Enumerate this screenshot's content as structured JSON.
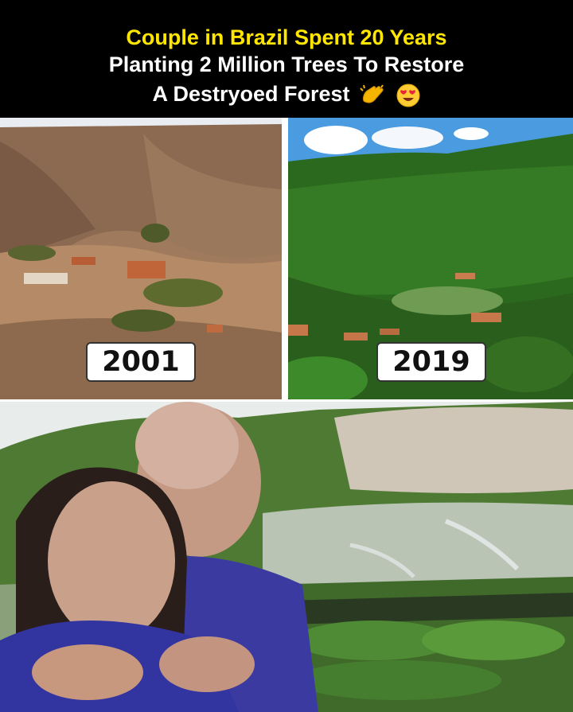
{
  "header": {
    "line1": "Couple in Brazil Spent 20 Years",
    "line2": "Planting 2 Million Trees To Restore",
    "line3": "A Destryoed Forest",
    "emojis": [
      "clapping-hands",
      "heart-eyes-face"
    ],
    "colors": {
      "line1": "#ffe600",
      "line2": "#ffffff",
      "background": "#000000"
    }
  },
  "panels": {
    "before": {
      "year": "2001"
    },
    "after": {
      "year": "2019"
    }
  }
}
